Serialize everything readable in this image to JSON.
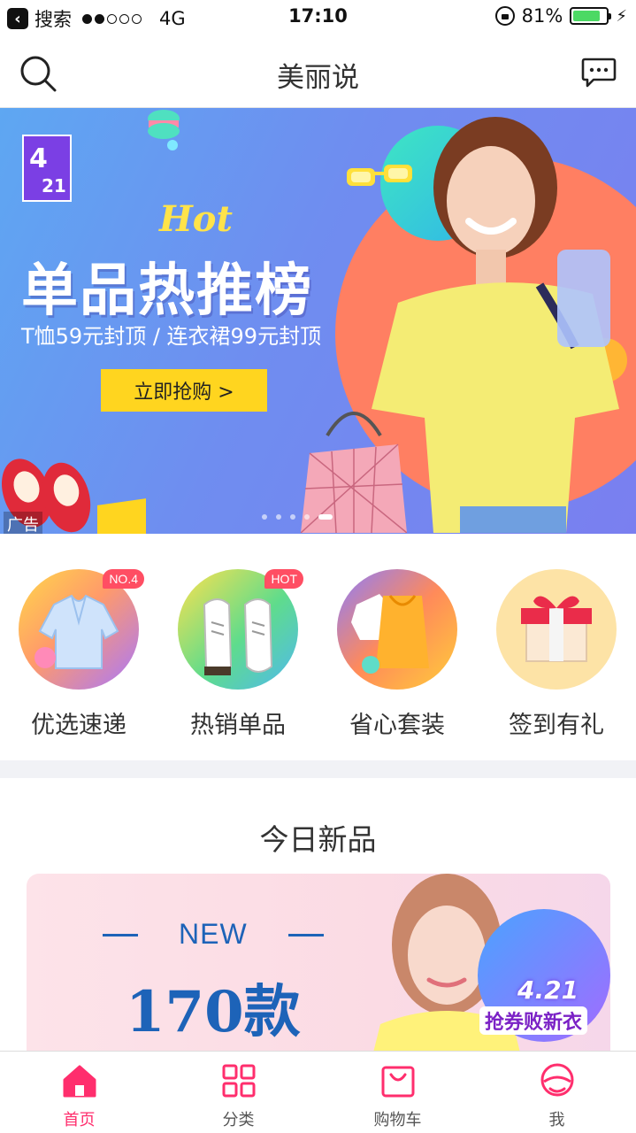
{
  "status_bar": {
    "back_app": "搜索",
    "network": "4G",
    "time": "17:10",
    "battery": "81%",
    "battery_level": 0.81,
    "signal_bars": 2,
    "signal_total": 5
  },
  "nav": {
    "title": "美丽说",
    "left_icon": "search-icon",
    "right_icon": "message-icon"
  },
  "banner": {
    "logo_top": "4",
    "logo_bottom": "21",
    "hot": "Hot",
    "title": "单品热推榜",
    "subtitle": "T恤59元封顶 / 连衣裙99元封顶",
    "button": "立即抢购 >",
    "ad_label": "广告",
    "slide_count": 5,
    "active_slide": 4
  },
  "categories": [
    {
      "label": "优选速递",
      "badge": "NO.4",
      "icon": "blouse-icon"
    },
    {
      "label": "热销单品",
      "badge": "HOT",
      "icon": "sneakers-icon"
    },
    {
      "label": "省心套装",
      "badge": "",
      "icon": "outfit-set-icon"
    },
    {
      "label": "签到有礼",
      "badge": "",
      "icon": "gift-box-icon"
    }
  ],
  "today": {
    "title": "今日新品",
    "new_label": "NEW",
    "count": "170款",
    "badge_date": "4.21",
    "badge_text": "抢券败新衣"
  },
  "tabbar": [
    {
      "label": "首页",
      "icon": "home-icon",
      "active": true
    },
    {
      "label": "分类",
      "icon": "category-grid-icon",
      "active": false
    },
    {
      "label": "购物车",
      "icon": "shopping-bag-icon",
      "active": false
    },
    {
      "label": "我",
      "icon": "profile-icon",
      "active": false
    }
  ],
  "colors": {
    "accent": "#ff2e6d",
    "banner_button": "#ffd51f",
    "new_blue": "#1d63b8",
    "battery_green": "#4cd964"
  }
}
